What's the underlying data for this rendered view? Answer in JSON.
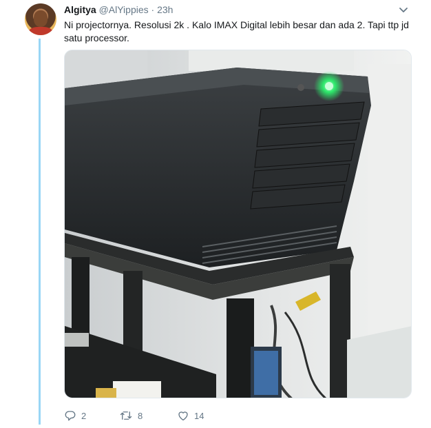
{
  "tweet": {
    "author_name": "Algitya",
    "author_handle": "@AlYippies",
    "separator": "·",
    "time": "23h",
    "text": "Ni projectornya. Resolusi 2k . Kalo IMAX Digital lebih besar dan ada 2. Tapi ttp jd satu processor.",
    "media_alt": "photo of a black digital cinema projector on a stand"
  },
  "actions": {
    "reply_count": "2",
    "retweet_count": "8",
    "like_count": "14"
  },
  "icons": {
    "caret": "chevron-down-icon",
    "reply": "reply-icon",
    "retweet": "retweet-icon",
    "like": "heart-icon"
  },
  "colors": {
    "thread_line": "#99d6f5",
    "secondary_text": "#657786",
    "projector_led": "#2ee86b"
  }
}
